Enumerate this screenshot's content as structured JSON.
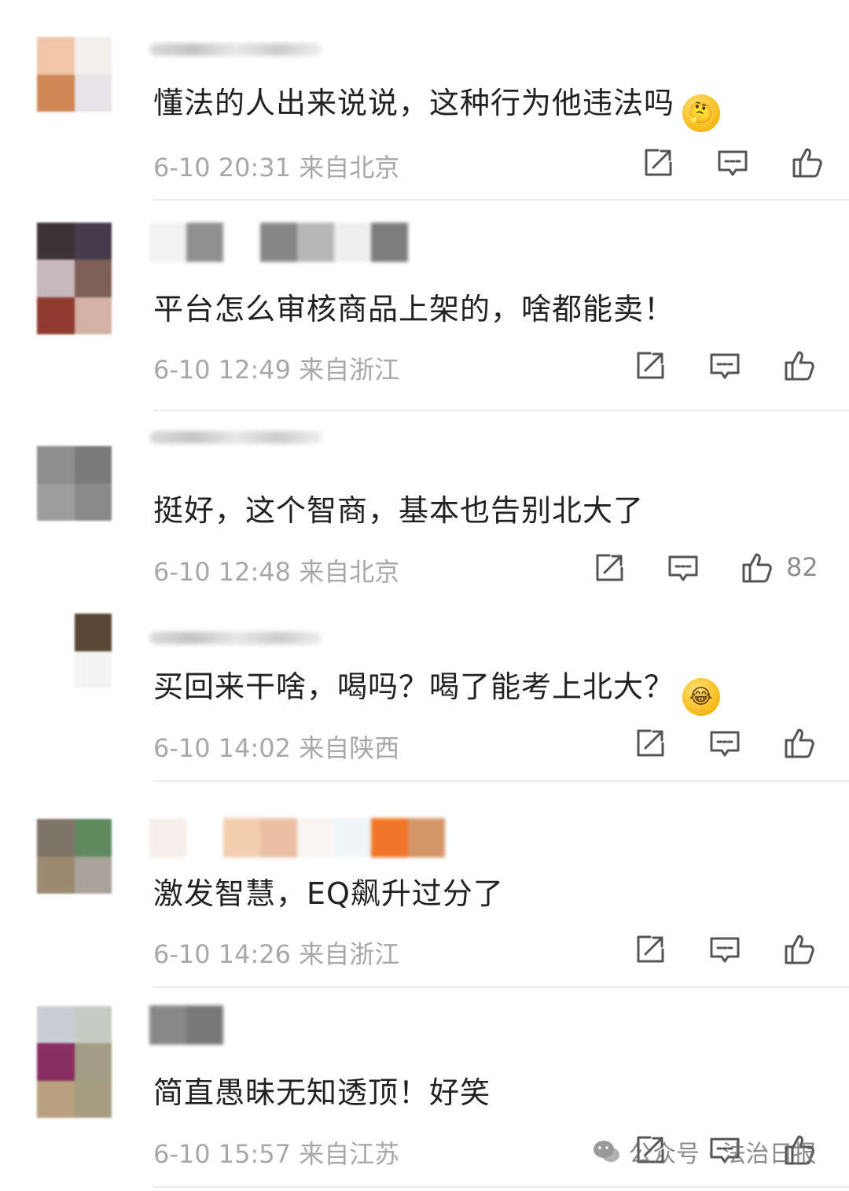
{
  "comments": [
    {
      "text": "懂法的人出来说说，这种行为他违法吗",
      "emoji": "🤔",
      "time": "6-10 20:31",
      "location": "来自北京",
      "likes": ""
    },
    {
      "text": "平台怎么审核商品上架的，啥都能卖！",
      "emoji": "",
      "time": "6-10 12:49",
      "location": "来自浙江",
      "likes": ""
    },
    {
      "text": "挺好，这个智商，基本也告别北大了",
      "emoji": "",
      "time": "6-10 12:48",
      "location": "来自北京",
      "likes": "82"
    },
    {
      "text": "买回来干啥，喝吗？喝了能考上北大？",
      "emoji": "😂",
      "time": "6-10 14:02",
      "location": "来自陕西",
      "likes": ""
    },
    {
      "text": "激发智慧，EQ飙升过分了",
      "emoji": "",
      "time": "6-10 14:26",
      "location": "来自浙江",
      "likes": ""
    },
    {
      "text": "简直愚昧无知透顶！好笑",
      "emoji": "",
      "time": "6-10 15:57",
      "location": "来自江苏",
      "likes": ""
    }
  ],
  "icons": [
    "share-icon",
    "comment-icon",
    "like-icon",
    "wechat-icon"
  ],
  "colors": {
    "text": "#222222",
    "meta": "#a8a8a8",
    "icon": "#555555",
    "divider": "#e9e9e9"
  },
  "watermark": {
    "label": "公众号 · 法治日报"
  }
}
